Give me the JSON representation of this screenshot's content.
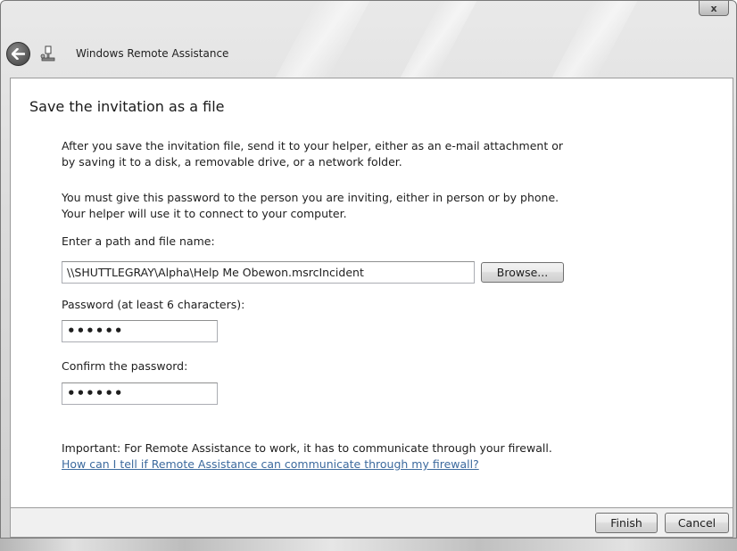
{
  "window": {
    "title": "Windows Remote Assistance",
    "close_glyph": "x"
  },
  "icons": {
    "back": "back-arrow-icon",
    "app": "remote-assistance-icon",
    "close": "close-icon"
  },
  "page": {
    "heading": "Save the invitation as a file",
    "para1_line1": "After you save the invitation file, send it to your helper, either as an e-mail attachment or",
    "para1_line2": "by saving it to a disk, a removable drive, or a network folder.",
    "para2_line1": "You must give this password to the person you are inviting, either in person or by phone.",
    "para2_line2": "Your helper will use it to connect to your computer."
  },
  "form": {
    "path_label": "Enter a path and file name:",
    "path_value": "\\\\SHUTTLEGRAY\\Alpha\\Help Me Obewon.msrcIncident",
    "browse_label": "Browse...",
    "password_label": "Password (at least 6 characters):",
    "password_value": "••••••",
    "confirm_label": "Confirm the password:",
    "confirm_value": "••••••"
  },
  "firewall": {
    "note": "Important: For Remote Assistance to work, it has to communicate through your firewall.",
    "link": "How can I tell if Remote Assistance can communicate through my firewall?"
  },
  "footer": {
    "finish_label": "Finish",
    "cancel_label": "Cancel"
  }
}
